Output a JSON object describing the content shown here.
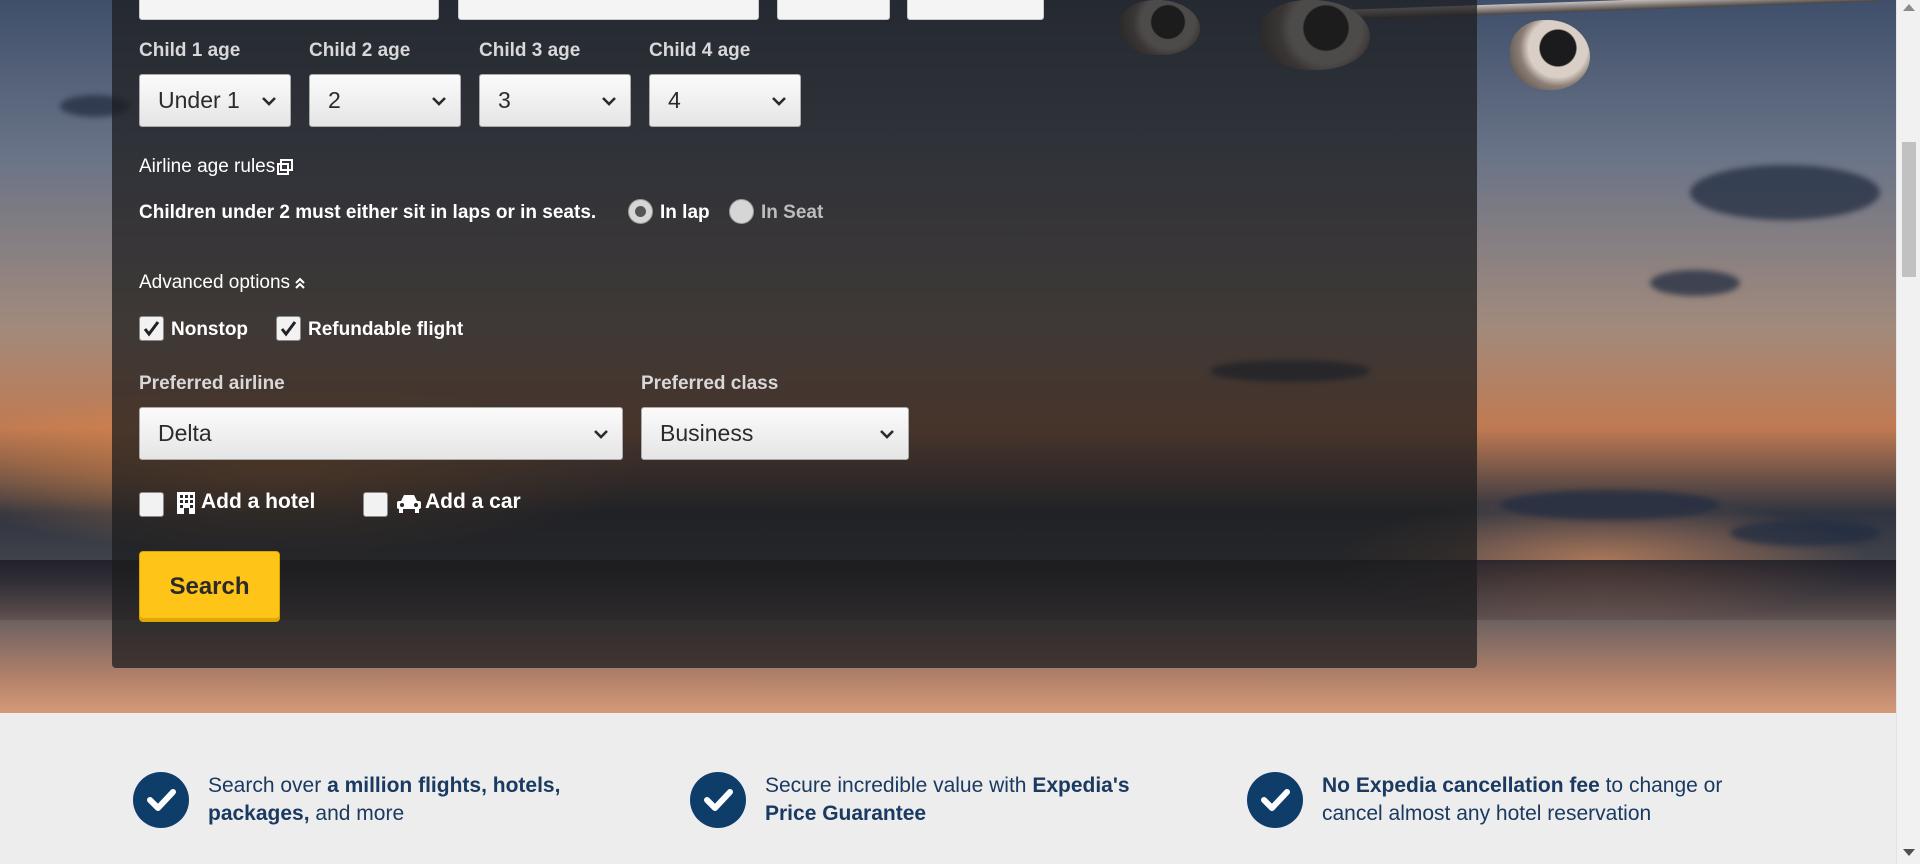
{
  "children": {
    "ages": [
      {
        "label": "Child 1 age",
        "value": "Under 1"
      },
      {
        "label": "Child 2 age",
        "value": "2"
      },
      {
        "label": "Child 3 age",
        "value": "3"
      },
      {
        "label": "Child 4 age",
        "value": "4"
      }
    ],
    "age_rules_link": "Airline age rules",
    "seating_prompt": "Children under 2 must either sit in laps or in seats.",
    "seating_options": [
      {
        "label": "In lap",
        "selected": true
      },
      {
        "label": "In Seat",
        "selected": false
      }
    ]
  },
  "advanced": {
    "toggle_label": "Advanced options",
    "nonstop": {
      "label": "Nonstop",
      "checked": true
    },
    "refundable": {
      "label": "Refundable flight",
      "checked": true
    },
    "airline": {
      "label": "Preferred airline",
      "value": "Delta"
    },
    "class": {
      "label": "Preferred class",
      "value": "Business"
    }
  },
  "addons": {
    "hotel": {
      "label": "Add a hotel",
      "checked": false,
      "icon": "building-icon"
    },
    "car": {
      "label": "Add a car",
      "checked": false,
      "icon": "car-icon"
    }
  },
  "search_button": "Search",
  "features": [
    {
      "pre": "Search over ",
      "bold": "a million flights, hotels, packages,",
      "post": " and more"
    },
    {
      "pre": "Secure incredible value with ",
      "bold": "Expedia's Price Guarantee",
      "post": ""
    },
    {
      "pre": "",
      "bold": "No Expedia cancellation fee",
      "post": " to change or cancel almost any hotel reservation"
    }
  ],
  "colors": {
    "accent": "#fec418",
    "brand_navy": "#0f3d6a",
    "panel": "#1c1c1e"
  }
}
